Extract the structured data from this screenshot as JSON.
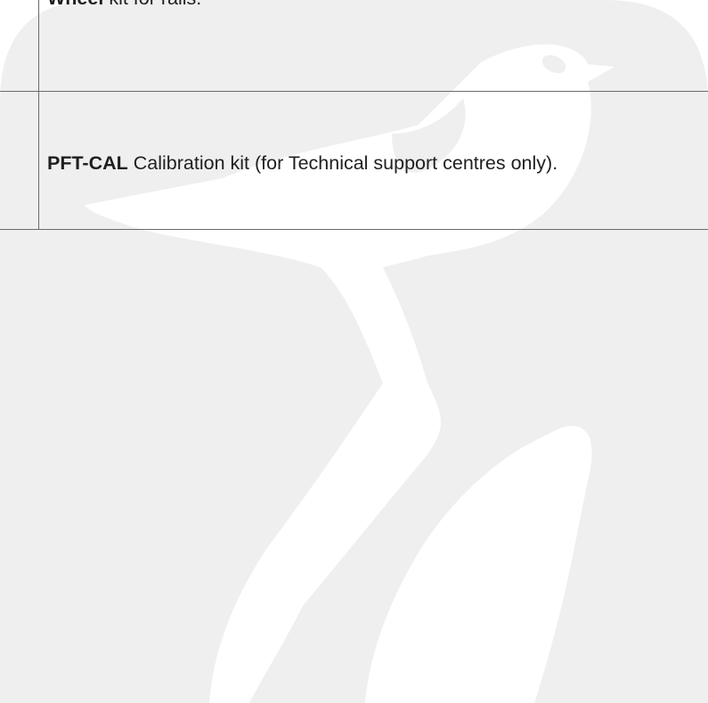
{
  "rows": [
    {
      "code": "Wheel",
      "description": "kit for rails."
    },
    {
      "code": "PFT-CAL",
      "description": "Calibration kit (for Technical support centres only)."
    }
  ],
  "colors": {
    "watermark": "#efefef",
    "rule": "#6b6b6b",
    "text": "#1f1f1f"
  },
  "watermark_icon": "bird-logo-icon"
}
